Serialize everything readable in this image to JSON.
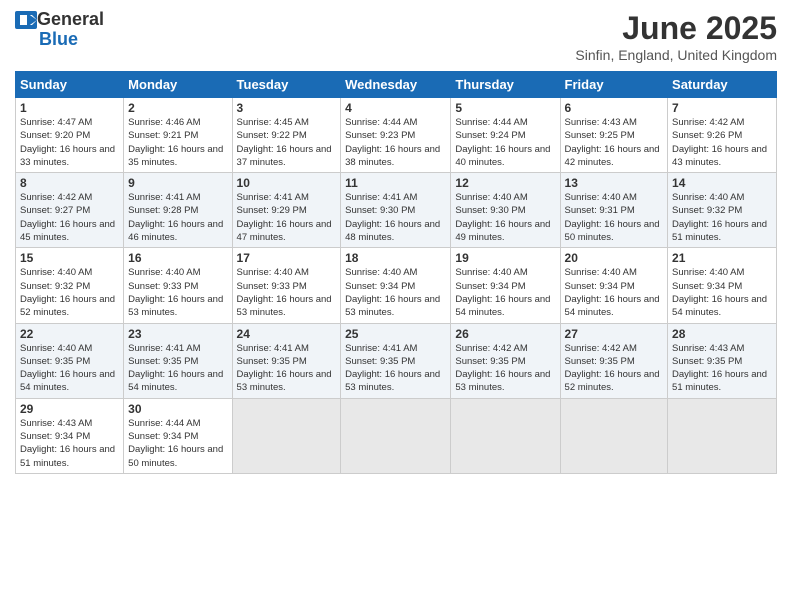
{
  "header": {
    "logo_general": "General",
    "logo_blue": "Blue",
    "month": "June 2025",
    "location": "Sinfin, England, United Kingdom"
  },
  "weekdays": [
    "Sunday",
    "Monday",
    "Tuesday",
    "Wednesday",
    "Thursday",
    "Friday",
    "Saturday"
  ],
  "weeks": [
    [
      {
        "day": "1",
        "sunrise": "4:47 AM",
        "sunset": "9:20 PM",
        "daylight": "16 hours and 33 minutes."
      },
      {
        "day": "2",
        "sunrise": "4:46 AM",
        "sunset": "9:21 PM",
        "daylight": "16 hours and 35 minutes."
      },
      {
        "day": "3",
        "sunrise": "4:45 AM",
        "sunset": "9:22 PM",
        "daylight": "16 hours and 37 minutes."
      },
      {
        "day": "4",
        "sunrise": "4:44 AM",
        "sunset": "9:23 PM",
        "daylight": "16 hours and 38 minutes."
      },
      {
        "day": "5",
        "sunrise": "4:44 AM",
        "sunset": "9:24 PM",
        "daylight": "16 hours and 40 minutes."
      },
      {
        "day": "6",
        "sunrise": "4:43 AM",
        "sunset": "9:25 PM",
        "daylight": "16 hours and 42 minutes."
      },
      {
        "day": "7",
        "sunrise": "4:42 AM",
        "sunset": "9:26 PM",
        "daylight": "16 hours and 43 minutes."
      }
    ],
    [
      {
        "day": "8",
        "sunrise": "4:42 AM",
        "sunset": "9:27 PM",
        "daylight": "16 hours and 45 minutes."
      },
      {
        "day": "9",
        "sunrise": "4:41 AM",
        "sunset": "9:28 PM",
        "daylight": "16 hours and 46 minutes."
      },
      {
        "day": "10",
        "sunrise": "4:41 AM",
        "sunset": "9:29 PM",
        "daylight": "16 hours and 47 minutes."
      },
      {
        "day": "11",
        "sunrise": "4:41 AM",
        "sunset": "9:30 PM",
        "daylight": "16 hours and 48 minutes."
      },
      {
        "day": "12",
        "sunrise": "4:40 AM",
        "sunset": "9:30 PM",
        "daylight": "16 hours and 49 minutes."
      },
      {
        "day": "13",
        "sunrise": "4:40 AM",
        "sunset": "9:31 PM",
        "daylight": "16 hours and 50 minutes."
      },
      {
        "day": "14",
        "sunrise": "4:40 AM",
        "sunset": "9:32 PM",
        "daylight": "16 hours and 51 minutes."
      }
    ],
    [
      {
        "day": "15",
        "sunrise": "4:40 AM",
        "sunset": "9:32 PM",
        "daylight": "16 hours and 52 minutes."
      },
      {
        "day": "16",
        "sunrise": "4:40 AM",
        "sunset": "9:33 PM",
        "daylight": "16 hours and 53 minutes."
      },
      {
        "day": "17",
        "sunrise": "4:40 AM",
        "sunset": "9:33 PM",
        "daylight": "16 hours and 53 minutes."
      },
      {
        "day": "18",
        "sunrise": "4:40 AM",
        "sunset": "9:34 PM",
        "daylight": "16 hours and 53 minutes."
      },
      {
        "day": "19",
        "sunrise": "4:40 AM",
        "sunset": "9:34 PM",
        "daylight": "16 hours and 54 minutes."
      },
      {
        "day": "20",
        "sunrise": "4:40 AM",
        "sunset": "9:34 PM",
        "daylight": "16 hours and 54 minutes."
      },
      {
        "day": "21",
        "sunrise": "4:40 AM",
        "sunset": "9:34 PM",
        "daylight": "16 hours and 54 minutes."
      }
    ],
    [
      {
        "day": "22",
        "sunrise": "4:40 AM",
        "sunset": "9:35 PM",
        "daylight": "16 hours and 54 minutes."
      },
      {
        "day": "23",
        "sunrise": "4:41 AM",
        "sunset": "9:35 PM",
        "daylight": "16 hours and 54 minutes."
      },
      {
        "day": "24",
        "sunrise": "4:41 AM",
        "sunset": "9:35 PM",
        "daylight": "16 hours and 53 minutes."
      },
      {
        "day": "25",
        "sunrise": "4:41 AM",
        "sunset": "9:35 PM",
        "daylight": "16 hours and 53 minutes."
      },
      {
        "day": "26",
        "sunrise": "4:42 AM",
        "sunset": "9:35 PM",
        "daylight": "16 hours and 53 minutes."
      },
      {
        "day": "27",
        "sunrise": "4:42 AM",
        "sunset": "9:35 PM",
        "daylight": "16 hours and 52 minutes."
      },
      {
        "day": "28",
        "sunrise": "4:43 AM",
        "sunset": "9:35 PM",
        "daylight": "16 hours and 51 minutes."
      }
    ],
    [
      {
        "day": "29",
        "sunrise": "4:43 AM",
        "sunset": "9:34 PM",
        "daylight": "16 hours and 51 minutes."
      },
      {
        "day": "30",
        "sunrise": "4:44 AM",
        "sunset": "9:34 PM",
        "daylight": "16 hours and 50 minutes."
      },
      null,
      null,
      null,
      null,
      null
    ]
  ]
}
